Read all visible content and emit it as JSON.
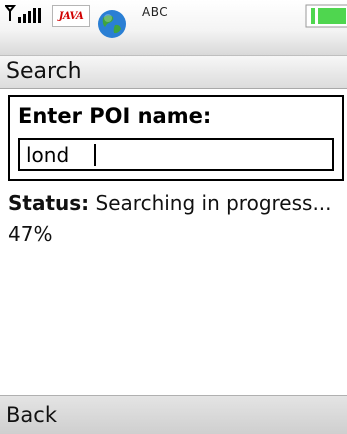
{
  "status_bar": {
    "signal_icon": "signal-strength-icon",
    "java_badge": "JAVA",
    "globe_icon": "globe-icon",
    "input_mode": "ABC",
    "battery_icon": "battery-icon",
    "battery_level": 0.85
  },
  "title": "Search",
  "form": {
    "label": "Enter POI name:",
    "value": "lond"
  },
  "status": {
    "label": "Status:",
    "text": " Searching in progress... 47%"
  },
  "softkeys": {
    "left": "Back"
  },
  "colors": {
    "battery_fill": "#4fd64f",
    "globe_ocean": "#2a7fd4",
    "globe_land": "#3fa43f",
    "java_text": "#d10000"
  }
}
